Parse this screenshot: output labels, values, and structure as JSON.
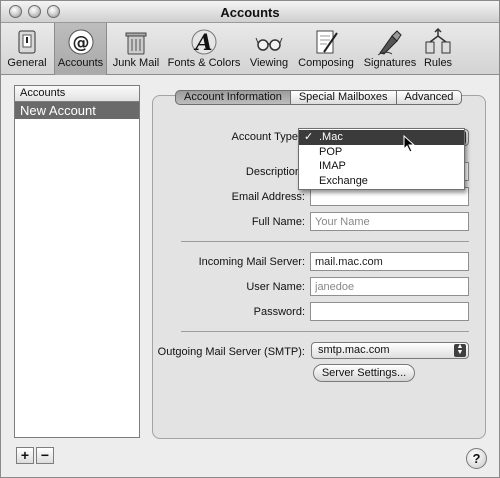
{
  "window": {
    "title": "Accounts"
  },
  "toolbar": {
    "items": [
      {
        "label": "General",
        "icon": "general-icon"
      },
      {
        "label": "Accounts",
        "icon": "at-sign-icon"
      },
      {
        "label": "Junk Mail",
        "icon": "trash-icon"
      },
      {
        "label": "Fonts & Colors",
        "icon": "font-letter-a-icon"
      },
      {
        "label": "Viewing",
        "icon": "glasses-icon"
      },
      {
        "label": "Composing",
        "icon": "pen-paper-icon"
      },
      {
        "label": "Signatures",
        "icon": "fountain-pen-icon"
      },
      {
        "label": "Rules",
        "icon": "rules-icon"
      }
    ],
    "active": "Accounts"
  },
  "sidebar": {
    "header": "Accounts",
    "items": [
      {
        "label": "New Account",
        "selected": true
      }
    ],
    "add_label": "+",
    "remove_label": "−"
  },
  "tabs": [
    {
      "label": "Account Information",
      "active": true
    },
    {
      "label": "Special Mailboxes"
    },
    {
      "label": "Advanced"
    }
  ],
  "form": {
    "account_type_label": "Account Type:",
    "description_label": "Description:",
    "email_label": "Email Address:",
    "full_name_label": "Full Name:",
    "full_name_placeholder": "Your Name",
    "incoming_label": "Incoming Mail Server:",
    "incoming_value": "mail.mac.com",
    "user_name_label": "User Name:",
    "user_name_placeholder": "janedoe",
    "password_label": "Password:",
    "password_value": "",
    "outgoing_label": "Outgoing Mail Server (SMTP):",
    "outgoing_value": "smtp.mac.com",
    "server_settings_label": "Server Settings..."
  },
  "account_type_menu": {
    "options": [
      ".Mac",
      "POP",
      "IMAP",
      "Exchange"
    ],
    "selected": ".Mac",
    "check_mark": "✓"
  },
  "help": {
    "label": "?"
  },
  "colors": {
    "selection": "#6a6a6a",
    "menu_highlight": "#3b3b3b"
  }
}
